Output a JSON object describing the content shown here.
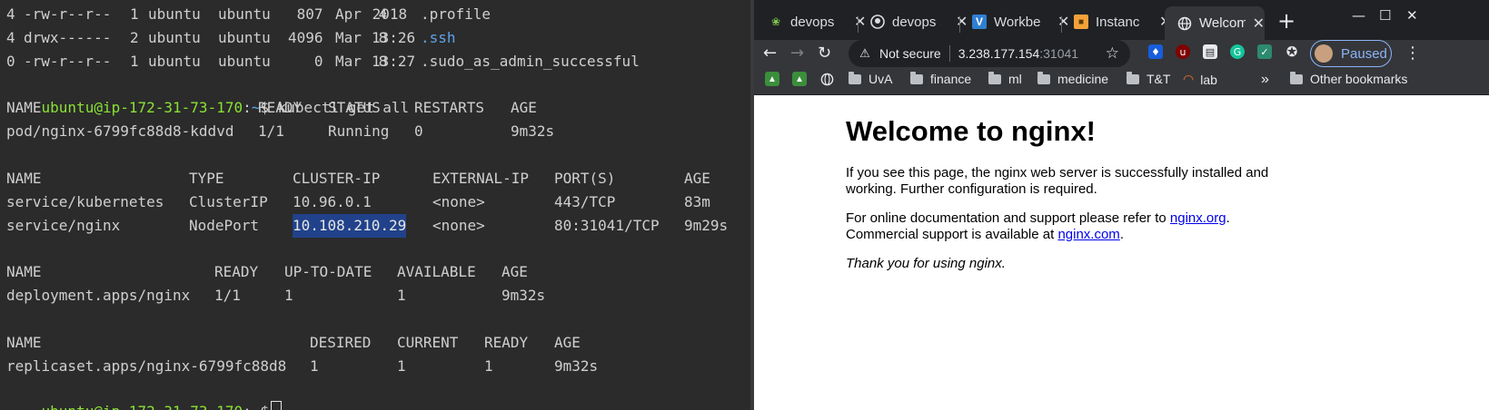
{
  "terminal": {
    "ls_lines": [
      {
        "blocks": "4",
        "perms": "-rw-r--r--",
        "links": "1",
        "owner": "ubuntu",
        "group": "ubuntu",
        "size": " 807",
        "month": "Apr",
        "day": " 4",
        "time": " 2018",
        "name": ".profile",
        "is_dir": false
      },
      {
        "blocks": "4",
        "perms": "drwx------",
        "links": "2",
        "owner": "ubuntu",
        "group": "ubuntu",
        "size": "4096",
        "month": "Mar",
        "day": " 8",
        "time": "13:26",
        "name": ".ssh",
        "is_dir": true
      },
      {
        "blocks": "0",
        "perms": "-rw-r--r--",
        "links": "1",
        "owner": "ubuntu",
        "group": "ubuntu",
        "size": "   0",
        "month": "Mar",
        "day": " 8",
        "time": "13:27",
        "name": ".sudo_as_admin_successful",
        "is_dir": false
      }
    ],
    "prompt": {
      "user_host": "ubuntu@ip-172-31-73-170",
      "path": "~",
      "symbol": "$"
    },
    "command": "kubectl get all",
    "pods": {
      "headers": [
        "NAME",
        "READY",
        "STATUS",
        "RESTARTS",
        "AGE"
      ],
      "rows": [
        [
          "pod/nginx-6799fc88d8-kddvd",
          "1/1",
          "Running",
          "0",
          "9m32s"
        ]
      ]
    },
    "services": {
      "headers": [
        "NAME",
        "TYPE",
        "CLUSTER-IP",
        "EXTERNAL-IP",
        "PORT(S)",
        "AGE"
      ],
      "rows": [
        [
          "service/kubernetes",
          "ClusterIP",
          "10.96.0.1",
          "<none>",
          "443/TCP",
          "83m"
        ],
        [
          "service/nginx",
          "NodePort",
          "10.108.210.29",
          "<none>",
          "80:31041/TCP",
          "9m29s"
        ]
      ],
      "selected_text": "10.108.210.29"
    },
    "deployments": {
      "headers": [
        "NAME",
        "READY",
        "UP-TO-DATE",
        "AVAILABLE",
        "AGE"
      ],
      "rows": [
        [
          "deployment.apps/nginx",
          "1/1",
          "1",
          "1",
          "9m32s"
        ]
      ]
    },
    "replicasets": {
      "headers": [
        "NAME",
        "DESIRED",
        "CURRENT",
        "READY",
        "AGE"
      ],
      "rows": [
        [
          "replicaset.apps/nginx-6799fc88d8",
          "1",
          "1",
          "1",
          "9m32s"
        ]
      ]
    }
  },
  "browser": {
    "tabs": [
      {
        "title": "devops",
        "icon": "leaf-icon",
        "active": false
      },
      {
        "title": "devops",
        "icon": "github-icon",
        "active": false
      },
      {
        "title": "Workbe",
        "icon": "vscode-icon",
        "active": false
      },
      {
        "title": "Instanc",
        "icon": "aws-box-icon",
        "active": false
      },
      {
        "title": "Welcom",
        "icon": "globe-icon",
        "active": true
      }
    ],
    "new_tab_symbol": "+",
    "address": {
      "security_label": "Not secure",
      "host": "3.238.177.154",
      "port": ":31041"
    },
    "profile_label": "Paused",
    "bookmarks": [
      {
        "label": "",
        "icon": "extension-bookmark-icon"
      },
      {
        "label": "",
        "icon": "extension-bookmark-icon"
      },
      {
        "label": "",
        "icon": "globe-icon"
      },
      {
        "label": "UvA",
        "icon": "folder-icon"
      },
      {
        "label": "finance",
        "icon": "folder-icon"
      },
      {
        "label": "ml",
        "icon": "folder-icon"
      },
      {
        "label": "medicine",
        "icon": "folder-icon"
      },
      {
        "label": "T&T",
        "icon": "folder-icon"
      },
      {
        "label": "lab",
        "icon": "jupyter-icon"
      }
    ],
    "overflow_symbol": "»",
    "other_bookmarks": "Other bookmarks",
    "page": {
      "heading": "Welcome to nginx!",
      "para1": "If you see this page, the nginx web server is successfully installed and working. Further configuration is required.",
      "para2_prefix": "For online documentation and support please refer to ",
      "link1": "nginx.org",
      "para2_mid": ".",
      "para2_line2": "Commercial support is available at ",
      "link2": "nginx.com",
      "para2_end": ".",
      "thanks": "Thank you for using nginx."
    }
  },
  "colors": {
    "terminal_bg": "#2b2b2b",
    "prompt_user": "#8ae234",
    "prompt_path": "#5fa3e8",
    "selection": "#21428a",
    "browser_chrome": "#35363a",
    "link": "#0000ee"
  }
}
